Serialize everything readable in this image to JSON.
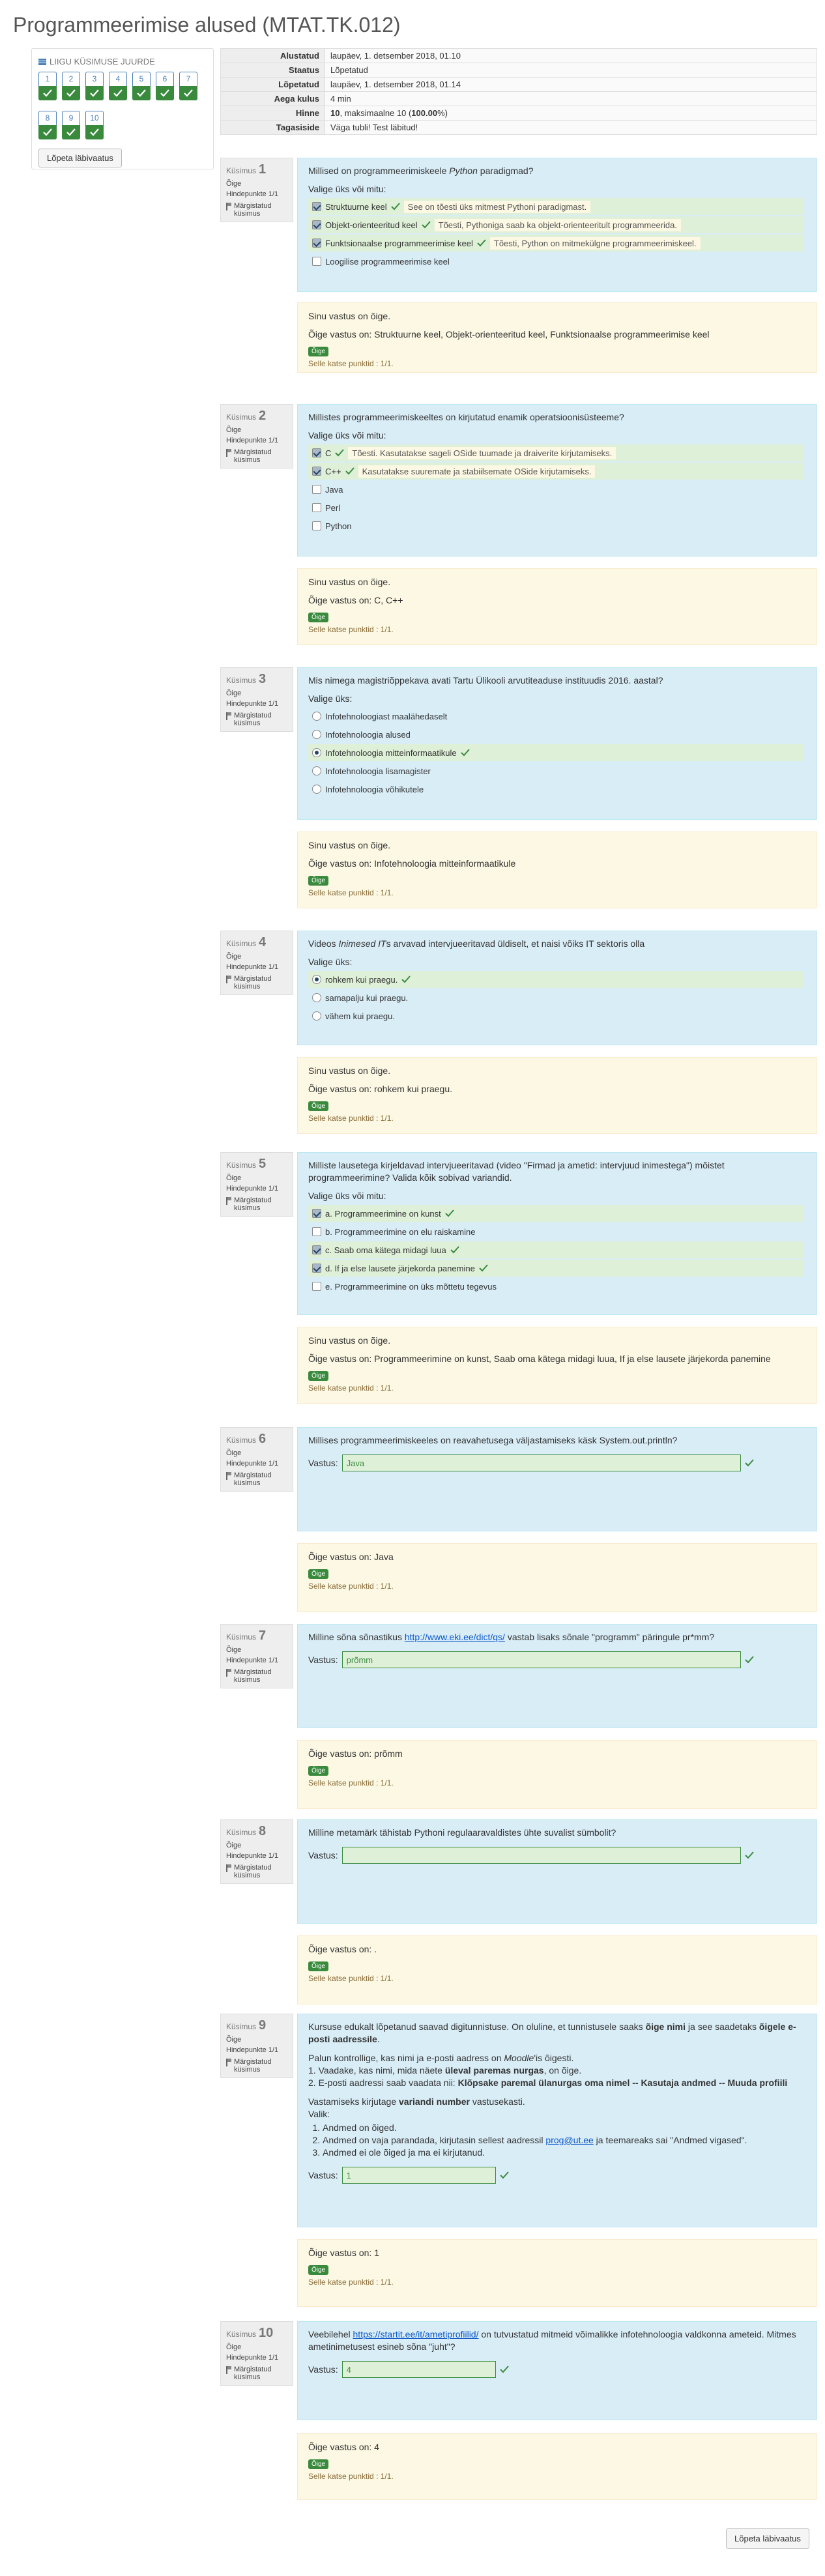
{
  "title": "Programmeerimise alused (MTAT.TK.012)",
  "nav": {
    "heading": "LIIGU KÜSIMUSE JUURDE",
    "items": [
      "1",
      "2",
      "3",
      "4",
      "5",
      "6",
      "7",
      "8",
      "9",
      "10"
    ],
    "finish": "Lõpeta läbivaatus"
  },
  "summary": [
    {
      "label": "Alustatud",
      "value": "laupäev, 1. detsember 2018, 01.10"
    },
    {
      "label": "Staatus",
      "value": "Lõpetatud"
    },
    {
      "label": "Lõpetatud",
      "value": "laupäev, 1. detsember 2018, 01.14"
    },
    {
      "label": "Aega kulus",
      "value": "4 min"
    },
    {
      "label": "Hinne",
      "value_bold1": "10",
      "value_mid": ", maksimaalne 10 (",
      "value_bold2": "100.00",
      "value_end": "%)"
    },
    {
      "label": "Tagasiside",
      "value": "Väga tubli! Test läbitud!"
    }
  ],
  "common": {
    "qword": "Küsimus",
    "status": "Õige",
    "marks": "Hindepunkte 1/1",
    "flag": "Märgistatud küsimus",
    "your_correct": "Sinu vastus on õige.",
    "badge": "Õige",
    "points": "Selle katse punktid : 1/1.",
    "answer_label": "Vastus:"
  },
  "q1": {
    "num": "1",
    "text_a": "Millised on programmeerimiskeele ",
    "text_i": "Python",
    "text_b": " paradigmad?",
    "prompt": "Valige üks või mitu:",
    "options": [
      {
        "label": "Struktuurne keel",
        "fb": "See on tõesti üks mitmest Pythoni paradigmast."
      },
      {
        "label": "Objekt-orienteeritud keel",
        "fb": "Tõesti, Pythoniga saab ka objekt-orienteeritult programmeerida."
      },
      {
        "label": "Funktsionaalse programmeerimise keel",
        "fb": "Tõesti, Python on mitmekülgne programmeerimiskeel."
      },
      {
        "label": "Loogilise programmeerimise keel",
        "fb": ""
      }
    ],
    "correct": "Õige vastus on: Struktuurne keel, Objekt-orienteeritud keel, Funktsionaalse programmeerimise keel"
  },
  "q2": {
    "num": "2",
    "text": "Millistes programmeerimiskeeltes on kirjutatud enamik operatsioonisüsteeme?",
    "prompt": "Valige üks või mitu:",
    "options": [
      {
        "label": "C",
        "fb": "Tõesti. Kasutatakse sageli OSide tuumade ja draiverite kirjutamiseks."
      },
      {
        "label": "C++",
        "fb": "Kasutatakse suuremate ja stabiilsemate OSide kirjutamiseks."
      },
      {
        "label": "Java",
        "fb": ""
      },
      {
        "label": "Perl",
        "fb": ""
      },
      {
        "label": "Python",
        "fb": ""
      }
    ],
    "correct": "Õige vastus on: C, C++"
  },
  "q3": {
    "num": "3",
    "text": "Mis nimega magistriõppekava avati Tartu Ülikooli arvutiteaduse instituudis 2016. aastal?",
    "prompt": "Valige üks:",
    "options": [
      "Infotehnoloogiast maalähedaselt",
      "Infotehnoloogia alused",
      "Infotehnoloogia mitteinformaatikule",
      "Infotehnoloogia lisamagister",
      "Infotehnoloogia võhikutele"
    ],
    "correct": "Õige vastus on: Infotehnoloogia mitteinformaatikule"
  },
  "q4": {
    "num": "4",
    "text_a": "Videos ",
    "text_i": "Inimesed IT",
    "text_b": "s arvavad intervjueeritavad üldiselt, et naisi võiks IT sektoris olla",
    "prompt": "Valige üks:",
    "options": [
      "rohkem kui praegu.",
      "samapalju kui praegu.",
      "vähem kui praegu."
    ],
    "correct": "Õige vastus on: rohkem kui praegu."
  },
  "q5": {
    "num": "5",
    "text": "Milliste lausetega kirjeldavad intervjueeritavad (video \"Firmad ja ametid: intervjuud inimestega\") mõistet programmeerimine? Valida kõik sobivad variandid.",
    "prompt": "Valige üks või mitu:",
    "options": [
      "a. Programmeerimine on kunst",
      "b. Programmeerimine on elu raiskamine",
      "c. Saab oma kätega midagi luua",
      "d. If ja else lausete järjekorda panemine",
      "e. Programmeerimine on üks mõttetu tegevus"
    ],
    "correct": "Õige vastus on: Programmeerimine on kunst, Saab oma kätega midagi luua, If ja else lausete järjekorda panemine"
  },
  "q6": {
    "num": "6",
    "text": "Millises programmeerimiskeeles on reavahetusega väljastamiseks käsk System.out.println?",
    "answer": "Java",
    "correct": "Õige vastus on: Java"
  },
  "q7": {
    "num": "7",
    "text_a": "Milline sõna sõnastikus ",
    "link": "http://www.eki.ee/dict/qs/",
    "text_b": " vastab lisaks sõnale \"programm\" päringule pr*mm?",
    "answer": "prõmm",
    "correct": "Õige vastus on: prõmm"
  },
  "q8": {
    "num": "8",
    "text": "Milline metamärk tähistab Pythoni regulaaravaldistes ühte suvalist sümbolit?",
    "answer": "",
    "correct": "Õige vastus on: ."
  },
  "q9": {
    "num": "9",
    "p1a": "Kursuse edukalt lõpetanud saavad digitunnistuse. On oluline, et tunnistusele saaks ",
    "p1b": "õige nimi",
    "p1c": " ja see saadetaks ",
    "p1d": "õigele e-posti aadressile",
    "p1e": ".",
    "p2a": "Palun kontrollige, kas nimi ja e-posti aadress on ",
    "p2i": "Moodle",
    "p2b": "'is õigesti.",
    "l1a": "1. Vaadake, kas nimi, mida näete ",
    "l1b": "üleval paremas nurgas",
    "l1c": ", on õige.",
    "l2a": "2. E-posti aadressi saab vaadata nii: ",
    "l2b": "Klõpsake paremal ülanurgas oma nimel -- Kasutaja andmed -- Muuda profiili",
    "p3a": "Vastamiseks kirjutage ",
    "p3b": "variandi number",
    "p3c": " vastusekasti.",
    "p4": "Valik:",
    "choices": [
      "Andmed on õiged.",
      "Andmed on vaja parandada, kirjutasin sellest aadressil ",
      "Andmed ei ole õiged ja ma ei kirjutanud."
    ],
    "email": "prog@ut.ee",
    "c2end": " ja teemareaks sai \"Andmed vigased\".",
    "answer": "1",
    "correct": "Õige vastus on: 1"
  },
  "q10": {
    "num": "10",
    "text_a": "Veebilehel ",
    "link": "https://startit.ee/it/ametiprofiilid/",
    "text_b": " on tutvustatud mitmeid võimalikke infotehnoloogia valdkonna ameteid. Mitmes ametinimetusest esineb sõna \"juht\"?",
    "answer": "4",
    "correct": "Õige vastus on: 4"
  },
  "finish_bottom": "Lõpeta läbivaatus"
}
